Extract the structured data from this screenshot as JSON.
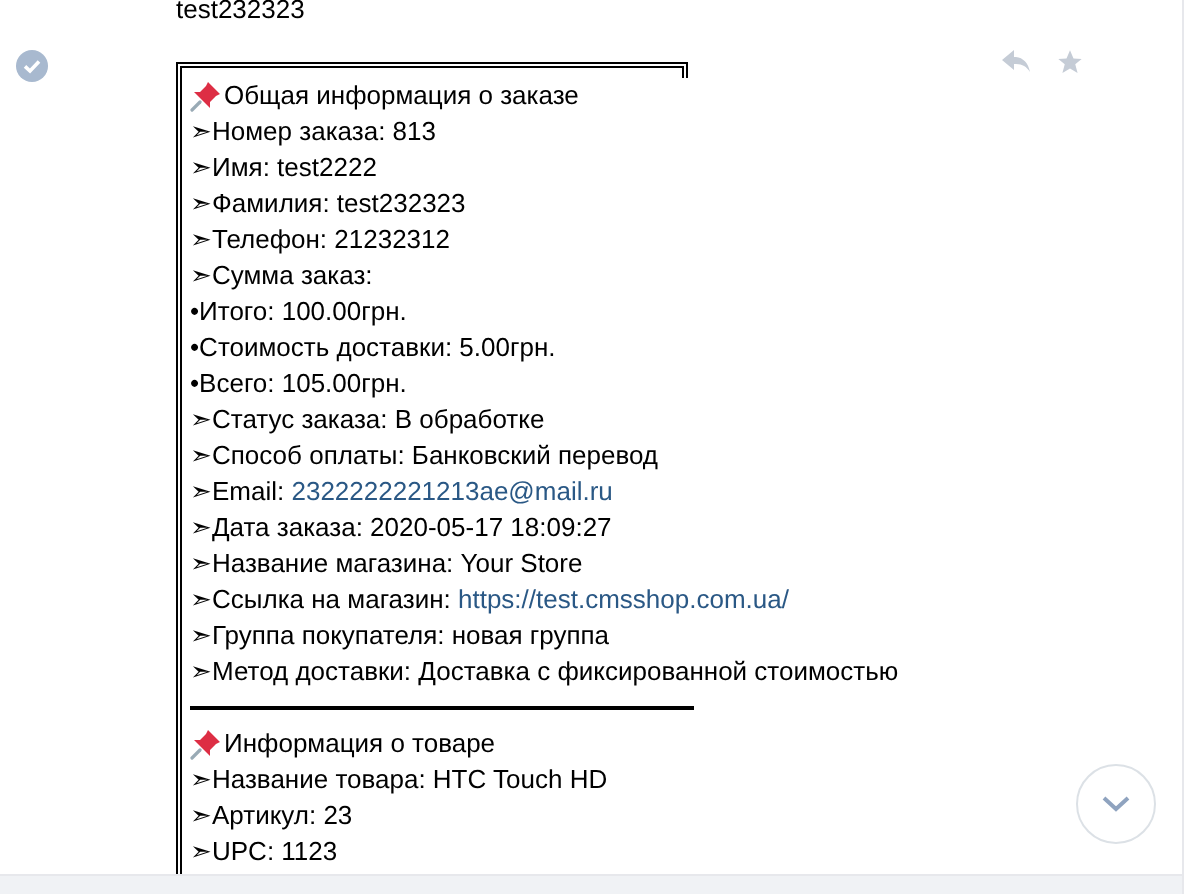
{
  "previous_message": {
    "text": "test232323"
  },
  "message": {
    "read": true,
    "lines": [
      {
        "kind": "heading",
        "text": "Общая информация о заказе"
      },
      {
        "kind": "line",
        "text": "➣Номер заказа: 813"
      },
      {
        "kind": "line",
        "text": "➣Имя: test2222"
      },
      {
        "kind": "line",
        "text": "➣Фамилия: test232323"
      },
      {
        "kind": "line",
        "text": "➣Телефон: 21232312"
      },
      {
        "kind": "line",
        "text": "➣Сумма заказ:"
      },
      {
        "kind": "line",
        "text": "•Итого: 100.00грн."
      },
      {
        "kind": "line",
        "text": "•Стоимость доставки: 5.00грн."
      },
      {
        "kind": "line",
        "text": "•Всего: 105.00грн."
      },
      {
        "kind": "line",
        "text": "➣Статус заказа: В обработке"
      },
      {
        "kind": "line",
        "text": "➣Способ оплаты: Банковский перевод"
      },
      {
        "kind": "line",
        "text": "➣Email: ",
        "link": "2322222221213ae@mail.ru"
      },
      {
        "kind": "line",
        "text": "➣Дата заказа: 2020-05-17 18:09:27"
      },
      {
        "kind": "line",
        "text": "➣Название магазина: Your Store"
      },
      {
        "kind": "line",
        "text": "➣Ссылка на магазин: ",
        "link": "https://test.cmsshop.com.ua/"
      },
      {
        "kind": "line",
        "text": "➣Группа покупателя: новая группа"
      },
      {
        "kind": "line",
        "text": "➣Метод доставки: Доставка с фиксированной стоимостью"
      },
      {
        "kind": "divider"
      },
      {
        "kind": "heading",
        "text": "Информация о товаре"
      },
      {
        "kind": "line",
        "text": "➣Название товара: HTC Touch HD"
      },
      {
        "kind": "line",
        "text": "➣Артикул: 23"
      },
      {
        "kind": "line",
        "text": "➣UPC: 1123"
      }
    ]
  }
}
